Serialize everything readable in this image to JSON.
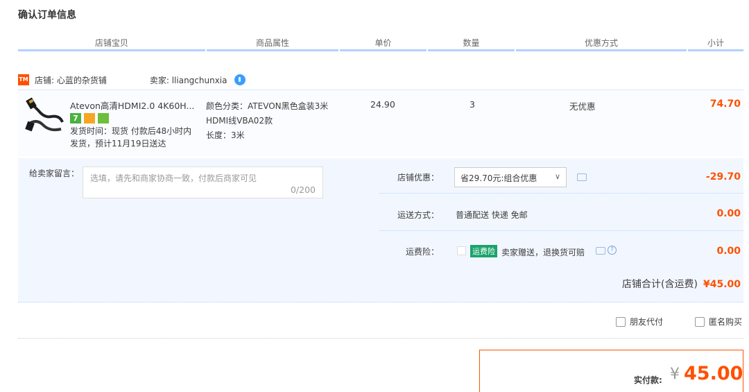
{
  "page_title": "确认订单信息",
  "columns": [
    "店铺宝贝",
    "商品属性",
    "单价",
    "数量",
    "优惠方式",
    "小计"
  ],
  "shop": {
    "icon_text": "TM",
    "name": "店铺: 心蓝的杂货铺",
    "seller": "卖家: lliangchunxia"
  },
  "item": {
    "name": "Atevon高清HDMI2.0 4K60H...",
    "badge_7": "7",
    "shipping_line1": "发货时间：现货 付款后48小时内",
    "shipping_line2": "发货，预计11月19日送达",
    "attr_line1": "颜色分类：ATEVON黑色盒装3米",
    "attr_line2": "HDMI线VBA02款",
    "attr_line3": "长度：3米",
    "price": "24.90",
    "quantity": "3",
    "discount": "无优惠",
    "subtotal": "74.70"
  },
  "message": {
    "label": "给卖家留言：",
    "placeholder": "选填，请先和商家协商一致，付款后商家可见",
    "count": "0/200"
  },
  "shop_discount": {
    "label": "店铺优惠：",
    "selected": "省29.70元:组合优惠",
    "amount": "-29.70"
  },
  "shipping": {
    "label": "运送方式：",
    "method": "普通配送 快递 免邮",
    "amount": "0.00"
  },
  "insurance": {
    "label": "运费险：",
    "tag": "运费险",
    "text": "卖家赠送，退换货可赔",
    "amount": "0.00"
  },
  "shop_total": {
    "label": "店铺合计(含运费)",
    "amount": "¥45.00"
  },
  "options": {
    "friend_pay": "朋友代付",
    "anonymous": "匿名购买"
  },
  "payment": {
    "label": "实付款:",
    "currency": "¥",
    "amount": "45.00"
  },
  "colors": {
    "accent": "#ff5000",
    "header_line": "#b2d1ff",
    "detail_bg": "#f2f7ff",
    "insurance_green": "#1aa36b"
  }
}
